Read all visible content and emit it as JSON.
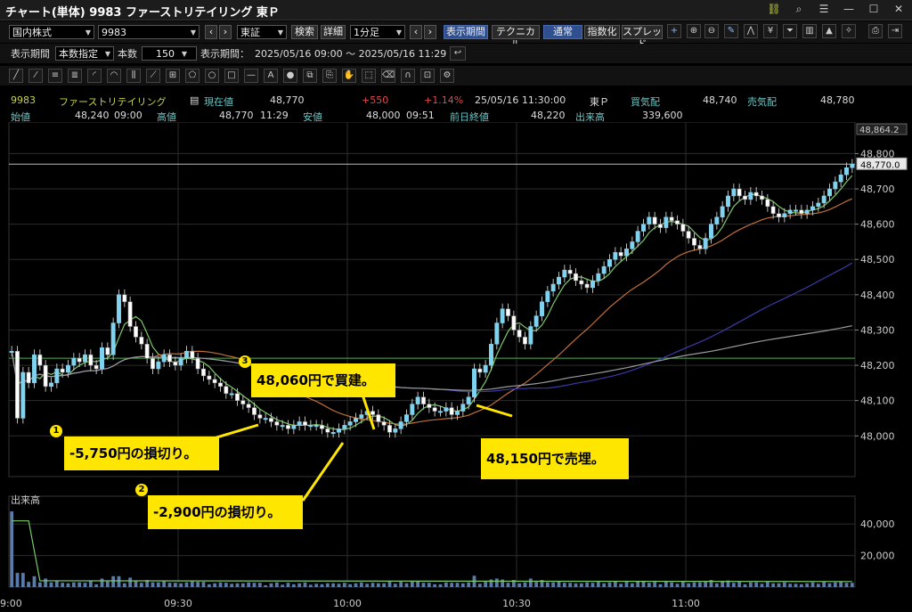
{
  "window": {
    "title": "チャート(単体) 9983 ファーストリテイリング 東Ｐ"
  },
  "toolbar1": {
    "market": "国内株式",
    "code": "9983",
    "exchange": "東証",
    "search": "検索",
    "detail": "詳細",
    "interval": "1分足",
    "display_period": "表示期間",
    "technical": "テクニカル",
    "normal": "通常",
    "index": "指数化",
    "spread": "スプレッド"
  },
  "toolbar2": {
    "display_period_label": "表示期間",
    "period_mode": "本数指定",
    "count_label": "本数",
    "count_value": "150",
    "display_range_label": "表示期間：",
    "display_range": "2025/05/16 09:00 ～ 2025/05/16 11:29"
  },
  "info1": {
    "code": "9983",
    "name": "ファーストリテイリング",
    "current_label": "現在値",
    "current": "48,770",
    "change": "+550",
    "change_pct": "+1.14%",
    "datetime": "25/05/16  11:30:00",
    "market": "東Ｐ",
    "bid_label": "買気配",
    "bid": "48,740",
    "ask_label": "売気配",
    "ask": "48,780"
  },
  "info2": {
    "open_label": "始値",
    "open": "48,240",
    "open_time": "09:00",
    "high_label": "高値",
    "high": "48,770",
    "high_time": "11:29",
    "low_label": "安値",
    "low": "48,000",
    "low_time": "09:51",
    "prev_label": "前日終値",
    "prev": "48,220",
    "volume_label": "出来高",
    "volume": "339,600"
  },
  "colors": {
    "up": "#7fd3ee",
    "down": "#ffffff",
    "accent": "#ffe600"
  },
  "chart": {
    "price_axis": [
      "48,800",
      "48,700",
      "48,600",
      "48,500",
      "48,400",
      "48,300",
      "48,200",
      "48,100",
      "48,000"
    ],
    "top_label": "48,864.2",
    "current_tag": "48,770.0",
    "volume_label": "出来高",
    "volume_axis": [
      "40,000",
      "20,000"
    ],
    "time_axis": [
      "9:00",
      "09:30",
      "10:00",
      "10:30",
      "11:00"
    ]
  },
  "callouts": [
    {
      "num": "1",
      "text": "-5,750円の損切り。"
    },
    {
      "num": "2",
      "text": "-2,900円の損切り。"
    },
    {
      "num": "3",
      "text": "48,060円で買建。"
    },
    {
      "num": "",
      "text": "48,150円で売埋。"
    }
  ],
  "chart_data": {
    "type": "line",
    "note_type": "candlestick",
    "x_range": [
      "09:00",
      "11:29"
    ],
    "ylim": [
      47930,
      48864.2
    ],
    "y_ticks": [
      48000,
      48100,
      48200,
      48300,
      48400,
      48500,
      48600,
      48700,
      48800
    ],
    "close": [
      48240,
      48050,
      48180,
      48150,
      48230,
      48200,
      48140,
      48150,
      48190,
      48180,
      48200,
      48220,
      48210,
      48230,
      48200,
      48190,
      48250,
      48230,
      48320,
      48400,
      48380,
      48310,
      48280,
      48260,
      48220,
      48190,
      48210,
      48230,
      48210,
      48200,
      48220,
      48240,
      48220,
      48190,
      48170,
      48160,
      48150,
      48140,
      48120,
      48120,
      48100,
      48090,
      48080,
      48060,
      48050,
      48050,
      48040,
      48030,
      48030,
      48020,
      48030,
      48040,
      48030,
      48030,
      48030,
      48020,
      48010,
      48010,
      48020,
      48030,
      48040,
      48050,
      48060,
      48070,
      48060,
      48040,
      48030,
      48010,
      48020,
      48040,
      48060,
      48090,
      48110,
      48090,
      48080,
      48070,
      48070,
      48080,
      48060,
      48070,
      48090,
      48110,
      48190,
      48180,
      48200,
      48260,
      48320,
      48360,
      48340,
      48300,
      48280,
      48260,
      48310,
      48340,
      48380,
      48410,
      48430,
      48450,
      48470,
      48460,
      48440,
      48430,
      48420,
      48440,
      48460,
      48480,
      48500,
      48520,
      48510,
      48530,
      48550,
      48580,
      48600,
      48620,
      48600,
      48590,
      48620,
      48610,
      48600,
      48580,
      48560,
      48540,
      48530,
      48560,
      48600,
      48620,
      48650,
      48680,
      48700,
      48680,
      48670,
      48690,
      48680,
      48670,
      48650,
      48630,
      48620,
      48630,
      48640,
      48640,
      48630,
      48640,
      48650,
      48660,
      48680,
      48700,
      48720,
      48740,
      48760,
      48770
    ],
    "hlines": [
      {
        "y": 48770
      },
      {
        "y": 48220
      }
    ],
    "volume_ylim": [
      0,
      52000
    ],
    "volume_ticks": [
      20000,
      40000
    ]
  }
}
